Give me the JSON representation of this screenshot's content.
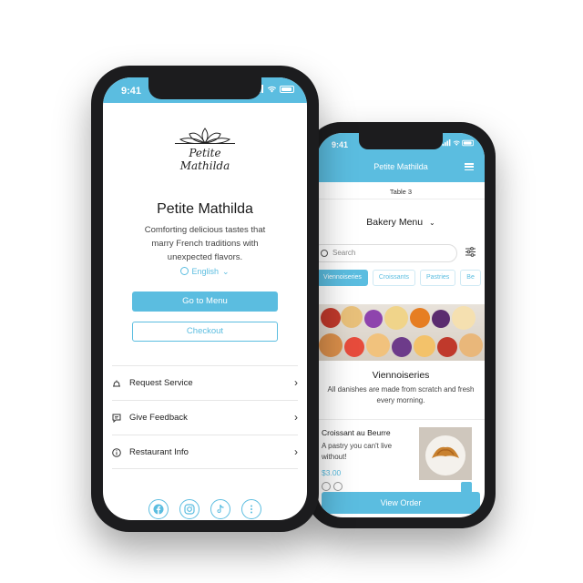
{
  "front": {
    "status_time": "9:41",
    "logo_line1": "Petite",
    "logo_line2": "Mathilda",
    "restaurant_name": "Petite Mathilda",
    "description": "Comforting delicious tastes that marry French traditions with unexpected flavors.",
    "language": "English",
    "go_to_menu": "Go to Menu",
    "checkout": "Checkout",
    "menu_items": [
      {
        "label": "Request Service",
        "icon": "bell-icon"
      },
      {
        "label": "Give Feedback",
        "icon": "feedback-icon"
      },
      {
        "label": "Restaurant Info",
        "icon": "info-icon"
      }
    ],
    "socials": [
      "facebook-icon",
      "instagram-icon",
      "tiktok-icon",
      "more-icon"
    ]
  },
  "back": {
    "status_time": "9:41",
    "header_title": "Petite Mathilda",
    "table_label": "Table 3",
    "menu_title": "Bakery Menu",
    "search_placeholder": "Search",
    "categories": [
      "Viennoiseries",
      "Croissants",
      "Pastries",
      "Be"
    ],
    "section_title": "Viennoiseries",
    "section_desc": "All danishes are made from scratch and fresh every morning.",
    "item": {
      "name": "Croissant au Beurre",
      "desc": "A pastry you can't live without!",
      "price": "$3.00"
    },
    "view_order": "View Order"
  },
  "colors": {
    "accent": "#5bbde0",
    "frame": "#1c1c1e"
  }
}
